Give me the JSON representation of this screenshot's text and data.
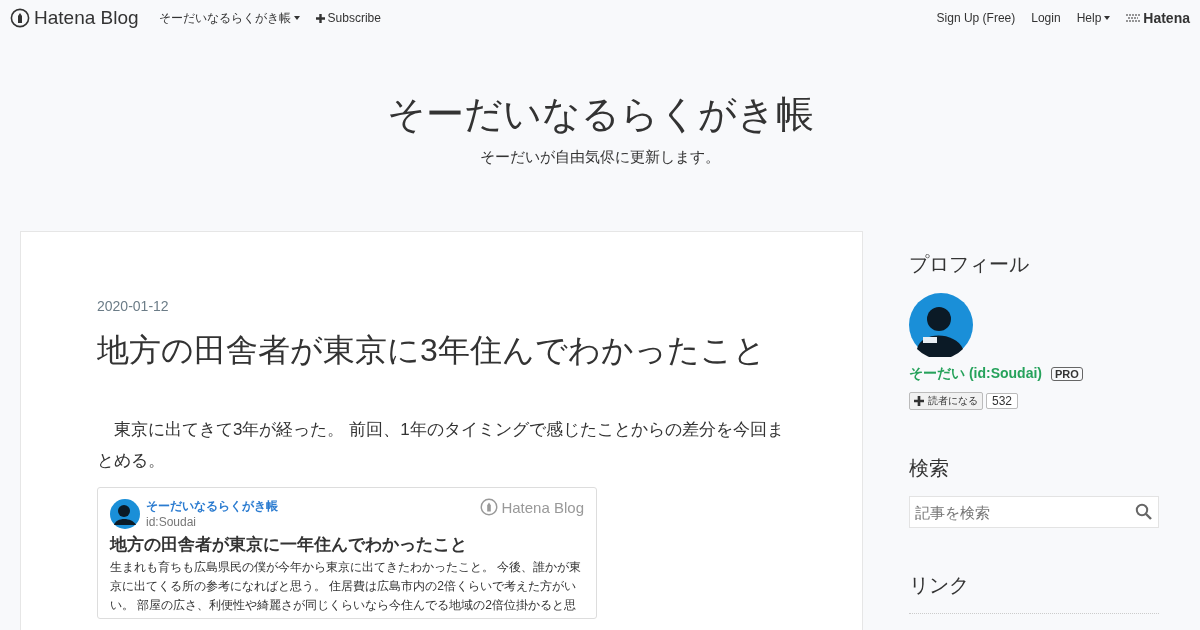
{
  "topbar": {
    "logo": "Hatena Blog",
    "blog_menu": "そーだいなるらくがき帳",
    "subscribe": "Subscribe",
    "links": [
      "Sign Up (Free)",
      "Login"
    ],
    "help": "Help",
    "brand": "Hatena"
  },
  "header": {
    "title": "そーだいなるらくがき帳",
    "description": "そーだいが自由気侭に更新します。"
  },
  "entry": {
    "date": "2020-01-12",
    "title": "地方の田舎者が東京に3年住んでわかったこと",
    "body": "東京に出てきて3年が経った。 前回、1年のタイミングで感じたことからの差分を今回まとめる。",
    "embed": {
      "blog_name": "そーだいなるらくがき帳",
      "user_id": "id:Soudai",
      "service": "Hatena Blog",
      "title": "地方の田舎者が東京に一年住んでわかったこと",
      "lines": [
        "生まれも育ちも広島県民の僕が今年から東京に出てきたわかったこと。 今後、誰かが東",
        "京に出てくる所の参考になればと思う。 住居費は広島市内の2倍くらいで考えた方がい",
        "い。 部屋の広さ、利便性や綺麗さが同じくらいなら今住んでる地域の2倍位掛かると思"
      ]
    }
  },
  "sidebar": {
    "profile": {
      "heading": "プロフィール",
      "name": "そーだい (id:Soudai)",
      "badge": "PRO",
      "follow": "読者になる",
      "count": "532"
    },
    "search": {
      "heading": "検索",
      "placeholder": "記事を検索"
    },
    "links": {
      "heading": "リンク"
    }
  }
}
